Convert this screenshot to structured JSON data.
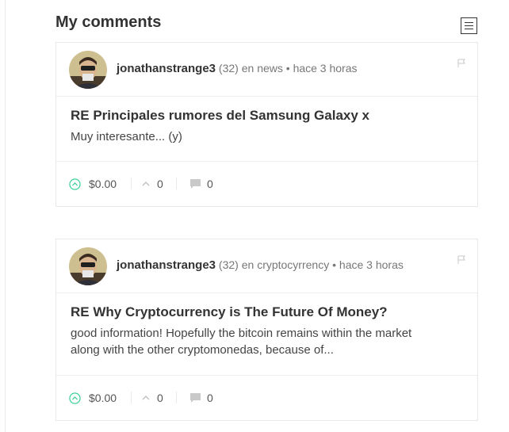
{
  "page": {
    "title": "My comments"
  },
  "toolbar": {
    "view_toggle_icon": "list-icon"
  },
  "colors": {
    "accent_green": "#2ecc8f",
    "text": "#333333",
    "muted": "#777777",
    "border": "#e9e9e9"
  },
  "comments": [
    {
      "author": "jonathanstrange3",
      "reputation": "(32)",
      "preposition": "en",
      "category": "news",
      "separator": "•",
      "time": "hace 3 horas",
      "title": "RE Principales rumores del Samsung Galaxy x",
      "excerpt": "Muy interesante... (y)",
      "payout": "$0.00",
      "votes": "0",
      "replies": "0"
    },
    {
      "author": "jonathanstrange3",
      "reputation": "(32)",
      "preposition": "en",
      "category": "cryptocyrrency",
      "separator": "•",
      "time": "hace 3 horas",
      "title": "RE Why Cryptocurrency is The Future Of Money?",
      "excerpt": "good information! Hopefully the bitcoin remains within the market along with the other cryptomonedas, because of...",
      "payout": "$0.00",
      "votes": "0",
      "replies": "0"
    }
  ]
}
